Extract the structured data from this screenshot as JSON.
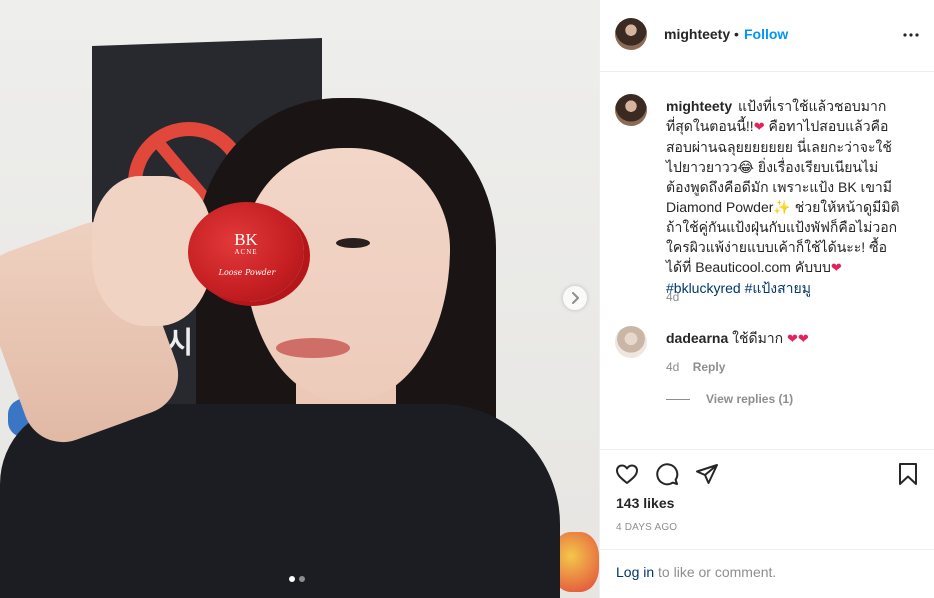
{
  "post": {
    "username": "mighteety",
    "follow_label": "Follow",
    "separator": "•",
    "caption": {
      "username": "mighteety",
      "segments": [
        {
          "type": "text",
          "value": " แป้งที่เราใช้แล้วชอบมากที่สุดในตอนนี้!!"
        },
        {
          "type": "emoji",
          "value": "❤"
        },
        {
          "type": "text",
          "value": " คือทาไปสอบแล้วคือสอบผ่านฉลุยยยยยยย นี่เลยกะว่าจะใช้ไปยาวยาวว"
        },
        {
          "type": "emoji",
          "value": "😂"
        },
        {
          "type": "text",
          "value": " ยิ่งเรื่องเรียบเนียนไม่ต้องพูดถึงคือดีมัก เพราะแป้ง BK เขามี Diamond Powder"
        },
        {
          "type": "emoji",
          "value": "✨"
        },
        {
          "type": "text",
          "value": " ช่วยให้หน้าดูมีมิติ ถ้าใช้คู่กันแป้งฝุ่นกับแป้งพัฟก็คือไม่วอก ใครผิวแพ้ง่ายแบบเค้าก็ใช้ได้นะะ! ซื้อได้ที่ Beauticool.com คับบบ"
        },
        {
          "type": "emoji",
          "value": "❤"
        },
        {
          "type": "text",
          "value": " "
        },
        {
          "type": "hashtag",
          "value": "#bkluckyred"
        },
        {
          "type": "text",
          "value": " "
        },
        {
          "type": "hashtag",
          "value": "#แป้งสายมู"
        }
      ],
      "time": "4d"
    },
    "comments": [
      {
        "username": "dadearna",
        "text": " ใช้ดีมาก",
        "emoji": "❤❤",
        "time": "4d",
        "reply_label": "Reply",
        "view_replies": "View replies (1)"
      }
    ],
    "likes": "143 likes",
    "date": "4 DAYS AGO",
    "login": {
      "link": "Log in",
      "rest": " to like or comment."
    },
    "photo": {
      "compact_brand": "BK",
      "compact_brand_sub": "ACNE",
      "compact_label": "Loose Powder",
      "bg_text": "쏘시",
      "carousel_dots": 2,
      "active_dot": 0
    }
  },
  "icons": {
    "more": "more-options-icon",
    "like": "heart-icon",
    "comment": "comment-icon",
    "share": "share-icon",
    "save": "bookmark-icon",
    "next": "chevron-right-icon"
  },
  "colors": {
    "accent": "#0095f6",
    "link": "#00376b",
    "meta": "#8e8e8e",
    "heart": "#e0245e"
  }
}
